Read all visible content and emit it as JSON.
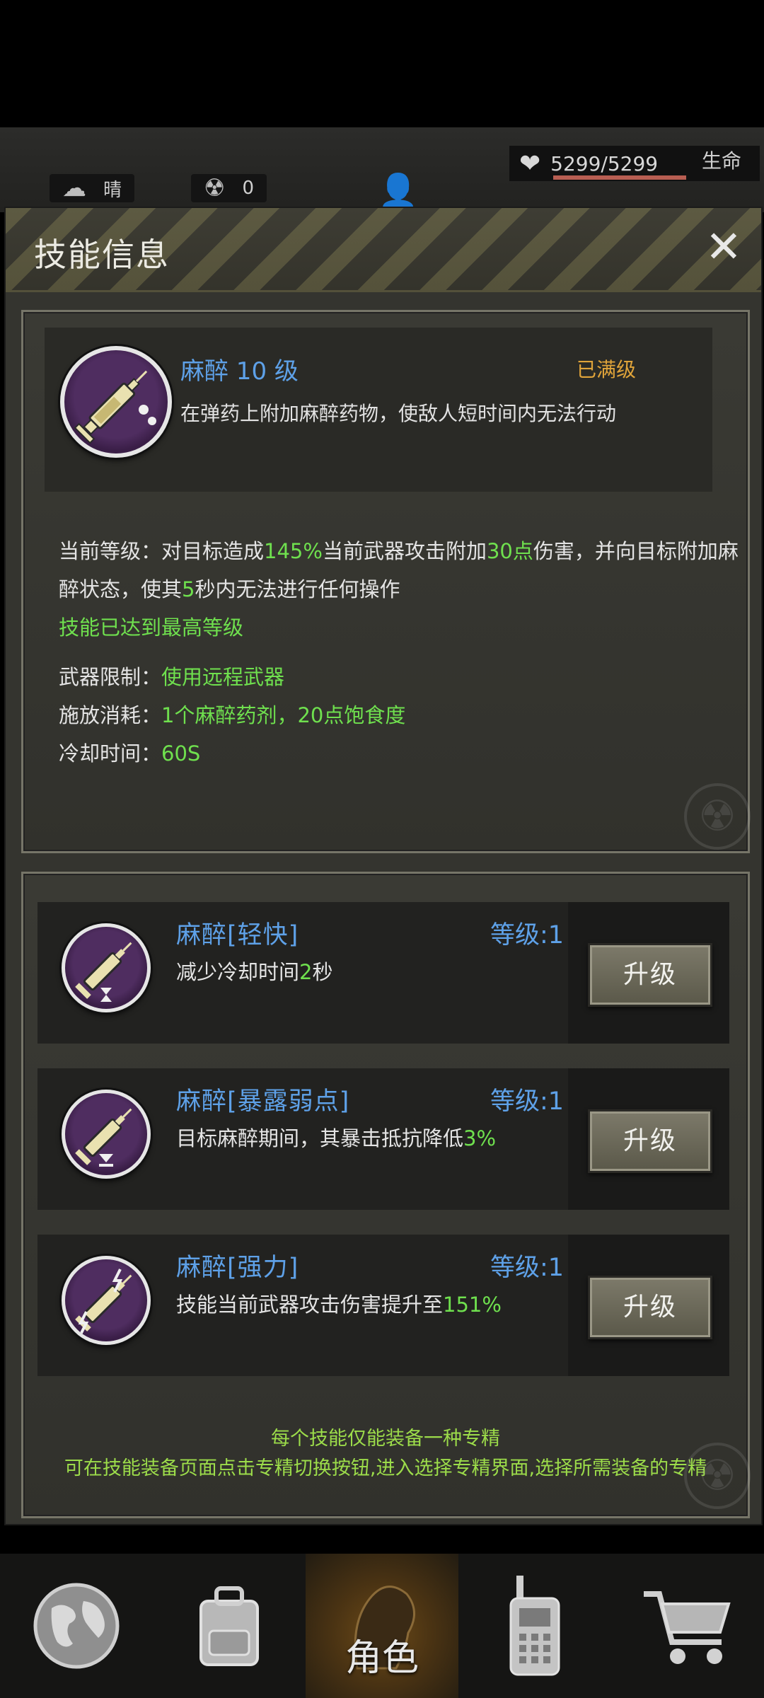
{
  "hud": {
    "weather_icon": "cloud-sun-icon",
    "weather": "晴",
    "radiation_icon": "radiation-icon",
    "radiation": "0",
    "hp": "5299/5299",
    "hp_label": "生命",
    "hp_fill": 1.0
  },
  "dialog": {
    "title": "技能信息",
    "close_label": "✕"
  },
  "skill": {
    "name": "麻醉 10 级",
    "max_badge": "已满级",
    "description": "在弹药上附加麻醉药物，使敌人短时间内无法行动",
    "current_prefix": "当前等级：对目标造成",
    "current_pct": "145%",
    "current_mid1": "当前武器攻击附加",
    "current_pts": "30点",
    "current_mid2": "伤害，并向目标附加麻",
    "current_line2_a": "醉状态，使其",
    "current_secs": "5",
    "current_line2_b": "秒内无法进行任何操作",
    "max_level_note": "技能已达到最高等级",
    "weapon_key": "武器限制：",
    "weapon_val": "使用远程武器",
    "cost_key": "施放消耗：",
    "cost_val": "1个麻醉药剂，20点饱食度",
    "cooldown_key": "冷却时间：",
    "cooldown_val": "60S"
  },
  "specializations": [
    {
      "name": "麻醉[轻快]",
      "level": "等级:1",
      "desc_a": "减少冷却时间",
      "desc_hl": "2",
      "desc_b": "秒",
      "button": "升级",
      "icon": "syringe-hourglass-icon"
    },
    {
      "name": "麻醉[暴露弱点]",
      "level": "等级:1",
      "desc_a": "目标麻醉期间，其暴击抵抗降低",
      "desc_hl": "3%",
      "desc_b": "",
      "button": "升级",
      "icon": "syringe-down-arrow-icon"
    },
    {
      "name": "麻醉[强力]",
      "level": "等级:1",
      "desc_a": "技能当前武器攻击伤害提升至",
      "desc_hl": "151%",
      "desc_b": "",
      "button": "升级",
      "icon": "syringe-lightning-icon"
    }
  ],
  "notes": {
    "line1": "每个技能仅能装备一种专精",
    "line2": "可在技能装备页面点击专精切换按钮,进入选择专精界面,选择所需装备的专精"
  },
  "nav": {
    "items": [
      {
        "name": "world",
        "icon": "globe-icon"
      },
      {
        "name": "backpack",
        "icon": "backpack-icon"
      },
      {
        "name": "character",
        "icon": "character-head-icon",
        "label": "角色",
        "active": true
      },
      {
        "name": "radio",
        "icon": "walkie-talkie-icon"
      },
      {
        "name": "shop",
        "icon": "cart-icon"
      }
    ]
  },
  "colors": {
    "accent_blue": "#5ea1e8",
    "highlight_green": "#6fe04e",
    "gold": "#e0a43a"
  }
}
